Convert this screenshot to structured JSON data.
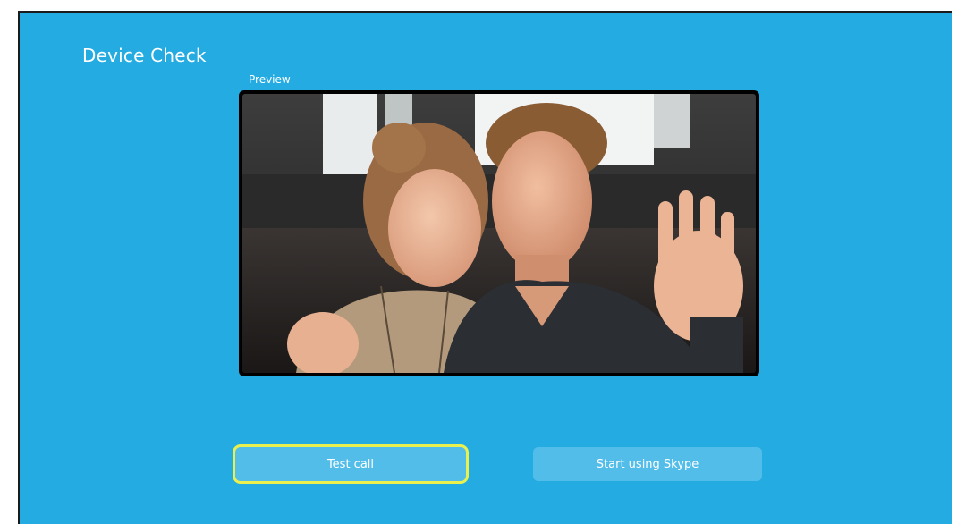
{
  "screen": {
    "title": "Device Check",
    "preview_label": "Preview",
    "buttons": {
      "test_call": "Test call",
      "start_using": "Start using Skype"
    }
  },
  "colors": {
    "background": "#24ace2",
    "button": "#53bde9",
    "focus_ring": "#eaf04e",
    "text": "#ffffff"
  }
}
